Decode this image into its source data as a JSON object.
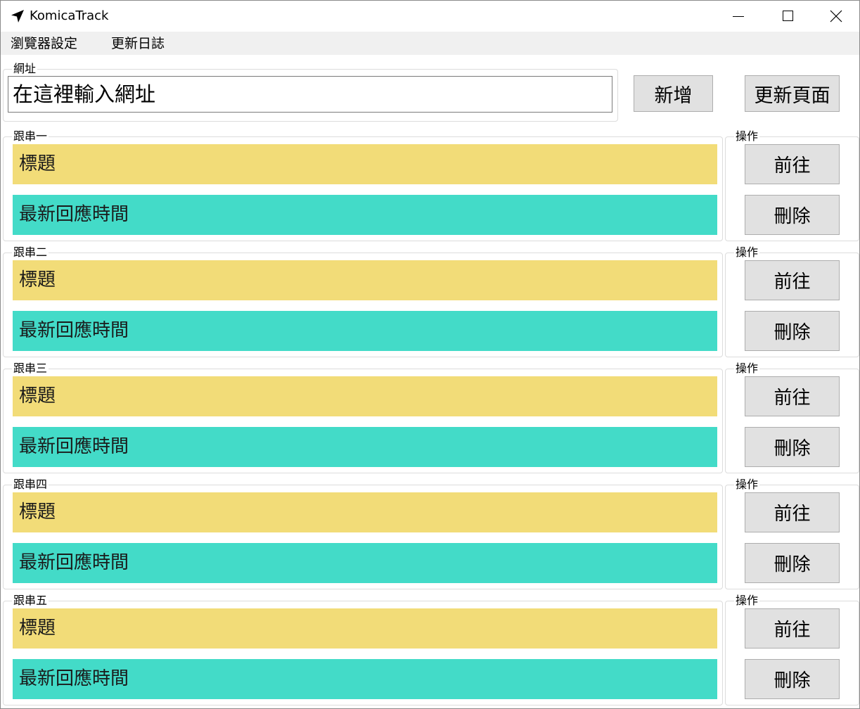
{
  "window": {
    "title": "KomicaTrack",
    "icon": "navigation-arrow-icon"
  },
  "menu": {
    "browser_settings": "瀏覽器設定",
    "changelog": "更新日誌"
  },
  "url": {
    "group_label": "網址",
    "placeholder": "在這裡輸入網址",
    "value": ""
  },
  "buttons": {
    "add": "新增",
    "refresh": "更新頁面"
  },
  "threads": [
    {
      "label": "跟串一",
      "title": "標題",
      "last_reply": "最新回應時間"
    },
    {
      "label": "跟串二",
      "title": "標題",
      "last_reply": "最新回應時間"
    },
    {
      "label": "跟串三",
      "title": "標題",
      "last_reply": "最新回應時間"
    },
    {
      "label": "跟串四",
      "title": "標題",
      "last_reply": "最新回應時間"
    },
    {
      "label": "跟串五",
      "title": "標題",
      "last_reply": "最新回應時間"
    }
  ],
  "ops": {
    "label": "操作",
    "go": "前往",
    "delete": "刪除"
  },
  "colors": {
    "title_bar": "#f2dc78",
    "reply_bar": "#43dbc8",
    "button_bg": "#e1e1e1"
  }
}
